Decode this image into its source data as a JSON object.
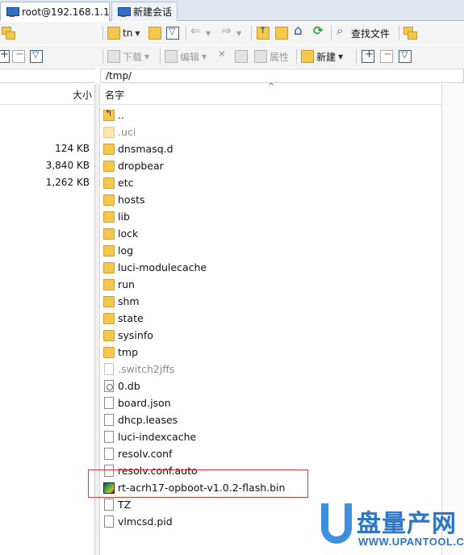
{
  "tabs": [
    {
      "label": "root@192.168.1.1",
      "active": true
    },
    {
      "label": "新建会话",
      "active": false
    }
  ],
  "toolbar1": {
    "path_combo": "tn",
    "find_label": "查找文件"
  },
  "toolbar2": {
    "download_label": "下载",
    "edit_label": "编辑",
    "properties_label": "属性",
    "new_label": "新建"
  },
  "remote_path": "/tmp/",
  "left_pane": {
    "size_header": "大小",
    "sizes": [
      "124 KB",
      "3,840 KB",
      "1,262 KB"
    ]
  },
  "right_pane": {
    "name_header": "名字",
    "files": [
      {
        "name": "..",
        "type": "up"
      },
      {
        "name": ".uci",
        "type": "folder-hidden"
      },
      {
        "name": "dnsmasq.d",
        "type": "folder"
      },
      {
        "name": "dropbear",
        "type": "folder"
      },
      {
        "name": "etc",
        "type": "folder"
      },
      {
        "name": "hosts",
        "type": "folder"
      },
      {
        "name": "lib",
        "type": "folder"
      },
      {
        "name": "lock",
        "type": "folder"
      },
      {
        "name": "log",
        "type": "folder"
      },
      {
        "name": "luci-modulecache",
        "type": "folder"
      },
      {
        "name": "run",
        "type": "folder"
      },
      {
        "name": "shm",
        "type": "folder"
      },
      {
        "name": "state",
        "type": "folder"
      },
      {
        "name": "sysinfo",
        "type": "folder"
      },
      {
        "name": "tmp",
        "type": "folder"
      },
      {
        "name": ".switch2jffs",
        "type": "file-hidden"
      },
      {
        "name": "0.db",
        "type": "db"
      },
      {
        "name": "board.json",
        "type": "file"
      },
      {
        "name": "dhcp.leases",
        "type": "file"
      },
      {
        "name": "luci-indexcache",
        "type": "file"
      },
      {
        "name": "resolv.conf",
        "type": "file"
      },
      {
        "name": "resolv.conf.auto",
        "type": "file"
      },
      {
        "name": "rt-acrh17-opboot-v1.0.2-flash.bin",
        "type": "bin"
      },
      {
        "name": "TZ",
        "type": "file"
      },
      {
        "name": "vlmcsd.pid",
        "type": "file"
      }
    ]
  },
  "watermark": {
    "brand": "盘量产网",
    "url": "WWW.UPANTOOL.COM"
  },
  "highlight_color": "#d93a3a"
}
